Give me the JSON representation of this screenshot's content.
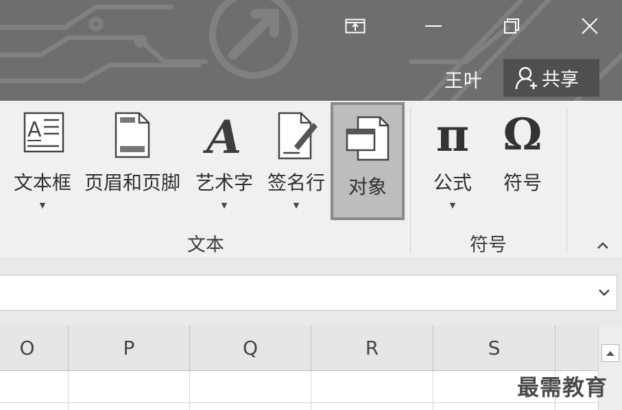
{
  "titlebar": {
    "user_name": "王叶",
    "share_label": "共享",
    "buttons": [
      "ribbon-display-options",
      "minimize",
      "restore",
      "close"
    ]
  },
  "ribbon": {
    "groups": [
      {
        "label": "文本",
        "buttons": [
          {
            "label": "文本框",
            "icon": "textbox-icon",
            "has_dropdown": true
          },
          {
            "label": "页眉和页脚",
            "icon": "header-footer-icon",
            "has_dropdown": false
          },
          {
            "label": "艺术字",
            "icon": "wordart-icon",
            "has_dropdown": true
          },
          {
            "label": "签名行",
            "icon": "signature-line-icon",
            "has_dropdown": true
          },
          {
            "label": "对象",
            "icon": "object-icon",
            "has_dropdown": false,
            "selected": true
          }
        ]
      },
      {
        "label": "符号",
        "buttons": [
          {
            "label": "公式",
            "icon": "pi-icon",
            "glyph": "π",
            "has_dropdown": true
          },
          {
            "label": "符号",
            "icon": "omega-icon",
            "glyph": "Ω",
            "has_dropdown": false
          }
        ]
      }
    ],
    "dropdown_glyph": "▼"
  },
  "formula_bar": {
    "value": ""
  },
  "grid": {
    "columns": [
      "O",
      "P",
      "Q",
      "R",
      "S"
    ]
  },
  "watermark": "最需教育",
  "colors": {
    "titlebar_bg": "#6e6e6e",
    "ribbon_bg": "#f0f0f0",
    "selected_button_bg": "#bdbdbd",
    "share_button_bg": "#4f4f4f"
  }
}
